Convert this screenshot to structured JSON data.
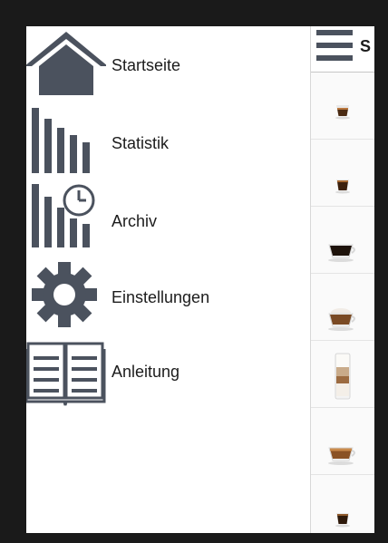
{
  "drawer": {
    "items": [
      {
        "label": "Startseite",
        "icon": "home-icon"
      },
      {
        "label": "Statistik",
        "icon": "bar-chart-icon"
      },
      {
        "label": "Archiv",
        "icon": "archive-clock-icon"
      },
      {
        "label": "Einstellungen",
        "icon": "gear-icon"
      },
      {
        "label": "Anleitung",
        "icon": "open-book-icon"
      }
    ]
  },
  "topbar": {
    "menu_icon": "hamburger-menu-icon",
    "title_partial": "S"
  },
  "list": {
    "items": [
      {
        "icon": "espresso-cup-icon"
      },
      {
        "icon": "espresso-cup-icon"
      },
      {
        "icon": "coffee-cup-icon"
      },
      {
        "icon": "cappuccino-cup-icon"
      },
      {
        "icon": "latte-macchiato-glass-icon"
      },
      {
        "icon": "coffee-crema-cup-icon"
      },
      {
        "icon": "espresso-cup-icon"
      }
    ]
  },
  "colors": {
    "icon_gray": "#4b525e",
    "frame": "#1a1a1a"
  }
}
